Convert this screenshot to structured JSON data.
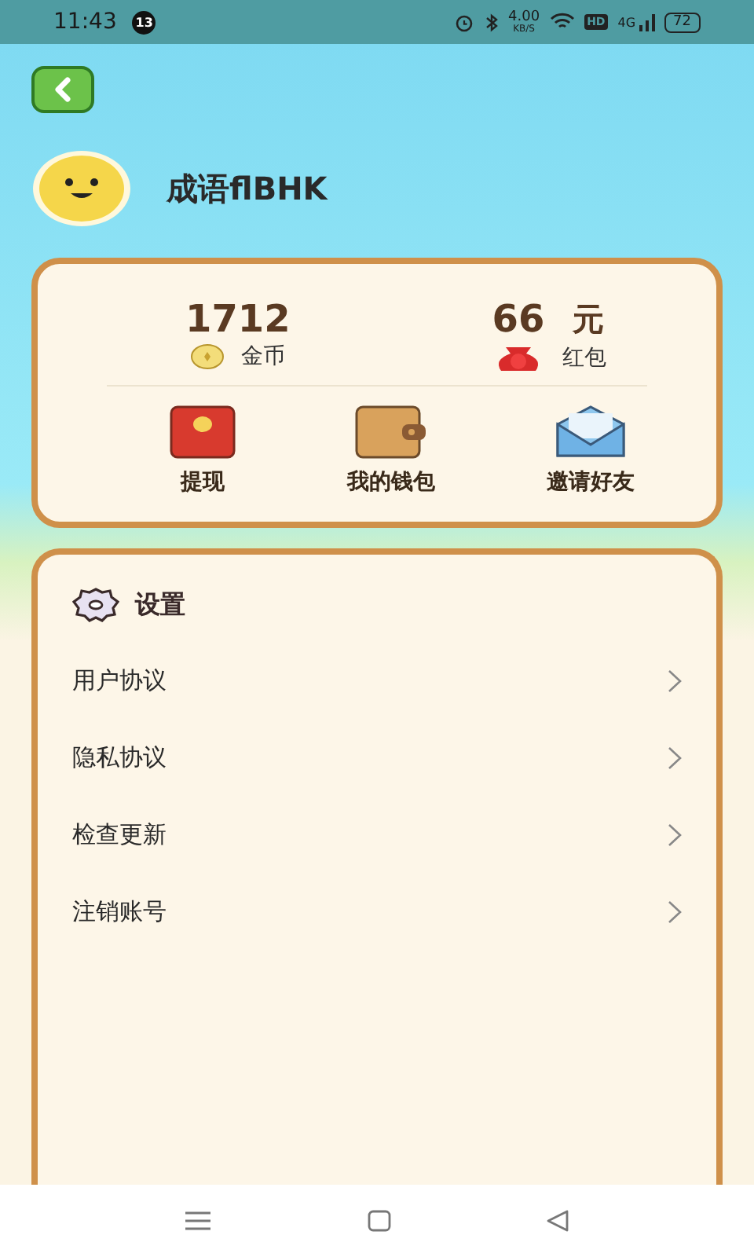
{
  "status_bar": {
    "time": "11:43",
    "notification_count": "13",
    "net_speed": "4.00",
    "net_unit": "KB/S",
    "hd": "HD",
    "network": "4G",
    "battery": "72"
  },
  "profile": {
    "name": "成语flBHK"
  },
  "wallet": {
    "coins": {
      "value": "1712",
      "label": "金币"
    },
    "red_packet": {
      "value": "66",
      "unit": "元",
      "label": "红包"
    },
    "actions": [
      {
        "kind": "withdraw",
        "label": "提现"
      },
      {
        "kind": "wallet",
        "label": "我的钱包"
      },
      {
        "kind": "invite",
        "label": "邀请好友"
      }
    ]
  },
  "settings": {
    "title": "设置",
    "items": [
      {
        "label": "用户协议"
      },
      {
        "label": "隐私协议"
      },
      {
        "label": "检查更新"
      },
      {
        "label": "注销账号"
      }
    ]
  }
}
